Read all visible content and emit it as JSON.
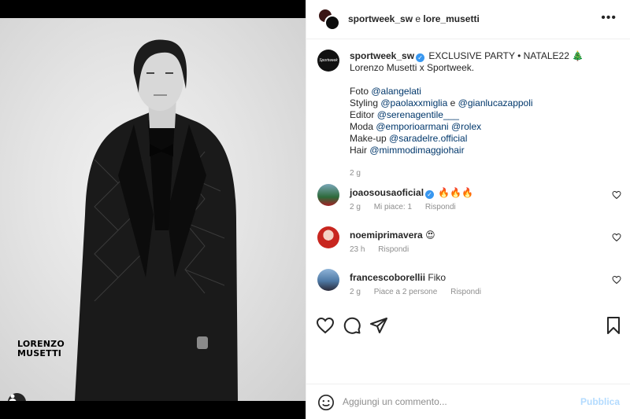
{
  "photo": {
    "caption_line1": "LORENZO",
    "caption_line2": "MUSETTI"
  },
  "header": {
    "user1": "sportweek_sw",
    "connector": "e",
    "user2": "lore_musetti",
    "more_icon": "more-horizontal-icon"
  },
  "caption": {
    "avatar_text": "Sportweek",
    "username": "sportweek_sw",
    "line1": "EXCLUSIVE PARTY • NATALE22 🎄",
    "line2": "Lorenzo Musetti x Sportweek.",
    "credits": [
      {
        "label": "Foto",
        "handle": "@alangelati"
      },
      {
        "label": "Styling",
        "handle": "@paolaxxmiglia",
        "joiner": "e",
        "handle2": "@gianlucazappoli"
      },
      {
        "label": "Editor",
        "handle": "@serenagentile___"
      },
      {
        "label": "Moda",
        "handle": "@emporioarmani",
        "handle2": "@rolex"
      },
      {
        "label": "Make-up",
        "handle": "@saradelre.official"
      },
      {
        "label": "Hair",
        "handle": "@mimmodimaggiohair"
      }
    ],
    "time": "2 g"
  },
  "comments": [
    {
      "username": "joaosousaoficial",
      "text": "🔥🔥🔥",
      "time": "2 g",
      "likes": "Mi piace: 1",
      "reply": "Rispondi"
    },
    {
      "username": "noemiprimavera",
      "text": "😍",
      "time": "23 h",
      "reply": "Rispondi"
    },
    {
      "username": "francescoborellii",
      "text": "Fiko",
      "time": "2 g",
      "likes": "Piace a 2 persone",
      "reply": "Rispondi"
    }
  ],
  "composer": {
    "placeholder": "Aggiungi un commento...",
    "publish": "Pubblica"
  },
  "colors": {
    "link": "#00376b",
    "verified": "#3897f0",
    "publish_disabled": "#b3dbff",
    "meta": "#8e8e8e"
  }
}
